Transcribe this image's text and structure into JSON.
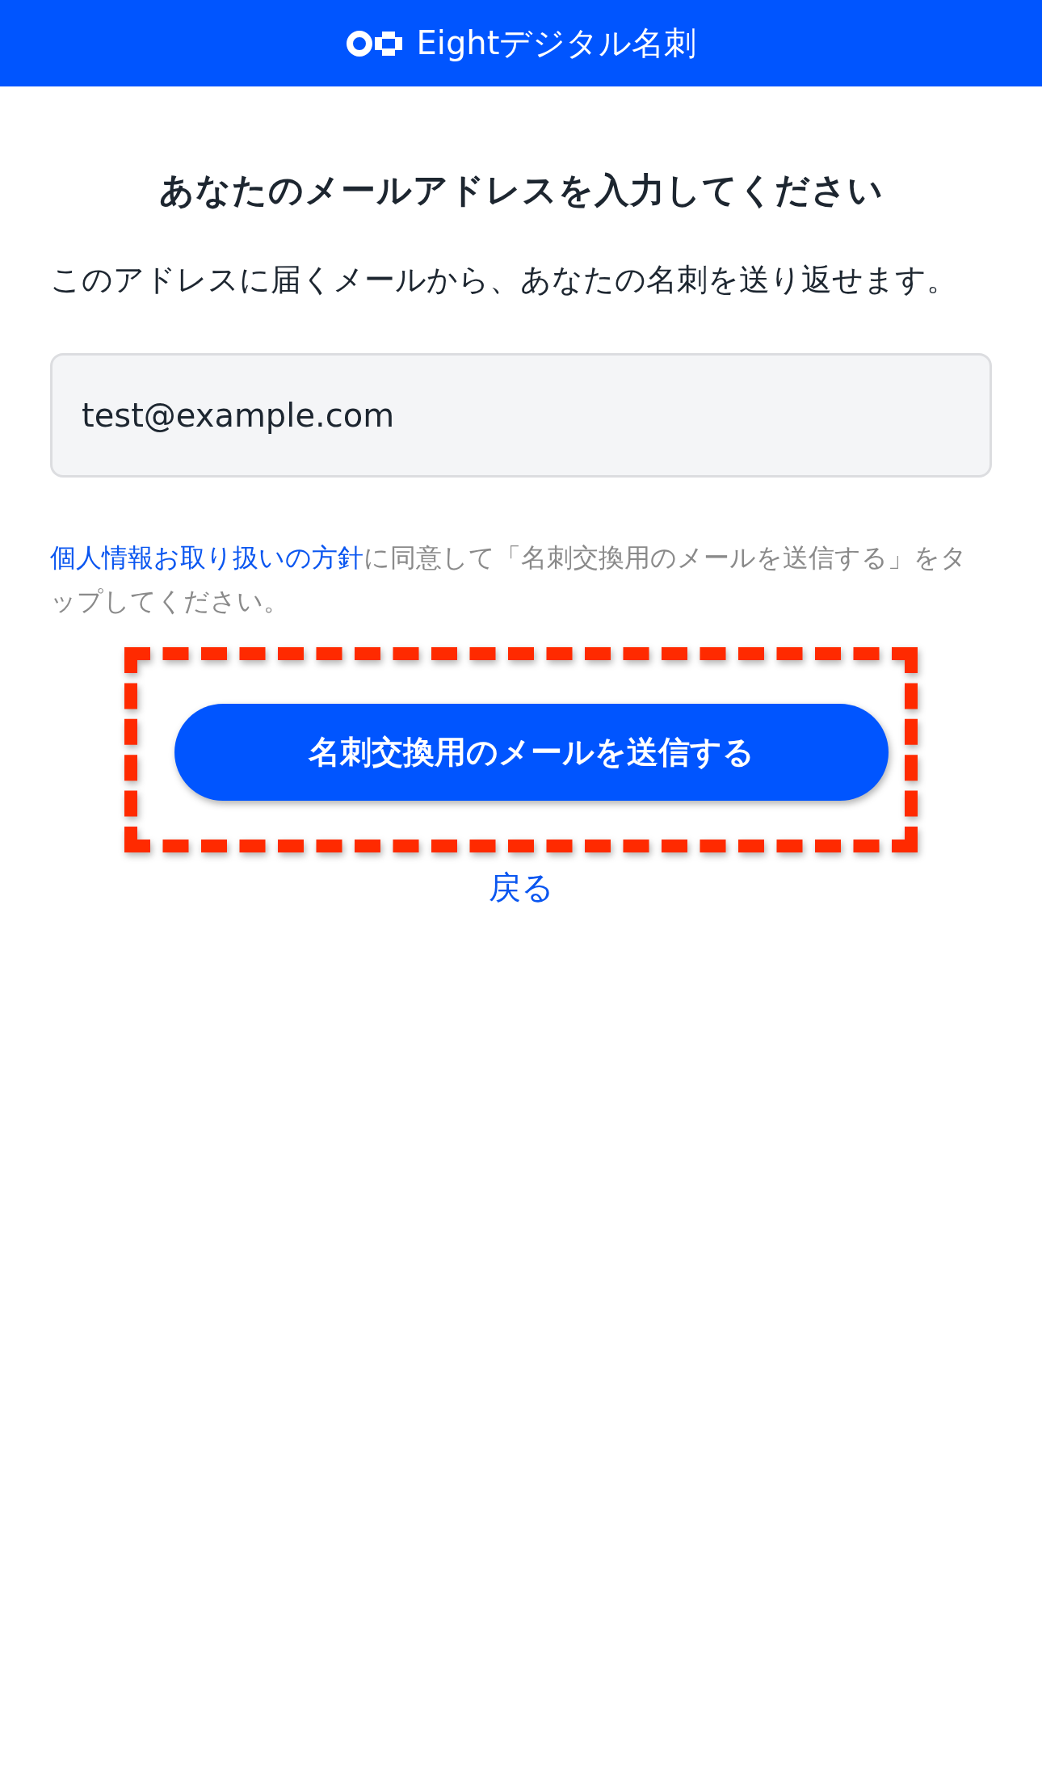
{
  "header": {
    "title": "Eightデジタル名刺"
  },
  "heading": "あなたのメールアドレスを入力してください",
  "description": "このアドレスに届くメールから、あなたの名刺を送り返せます。",
  "email_field": {
    "value": "test@example.com"
  },
  "consent": {
    "link": "個人情報お取り扱いの方針",
    "text": "に同意して「名刺交換用のメールを送信する」をタップしてください。"
  },
  "submit_button": {
    "label": "名刺交換用のメールを送信する",
    "highlighted": true
  },
  "back_link": "戻る"
}
